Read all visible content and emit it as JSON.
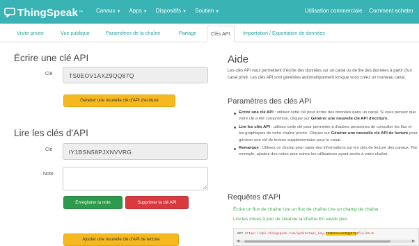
{
  "topnav": {
    "brand": "ThingSpeak",
    "brand_tm": "™",
    "menu": [
      "Canaux",
      "Apps",
      "Dispositifs",
      "Soutien"
    ],
    "right": [
      "Utilisation commerciale",
      "Comment acheter"
    ]
  },
  "tabs": [
    "Visite privée",
    "Vue publique",
    "Paramètres de la chaîne",
    "Partage",
    "Clés API",
    "Importation / Exportation de données"
  ],
  "write_section": {
    "title": "Écrire une clé API",
    "key_label": "Clé",
    "key_value": "TS0EOV1AXZ9QQ87Q",
    "generate_button": "Générer une nouvelle clé d'API d'écriture"
  },
  "read_section": {
    "title": "Lire les clés d'API",
    "key_label": "Clé",
    "key_value": "IY1BSN58PJXNVVRG",
    "note_label": "Note",
    "save_button": "Enregistrer la note",
    "delete_button": "Supprimer la clé API",
    "add_button": "Ajouter une nouvelle clé d'API de lecture"
  },
  "help": {
    "title": "Aide",
    "intro": "Les clés API vous permettent d'écrire des données sur un canal ou de lire des données à partir d'un canal privé. Les clés API sont générées automatiquement lorsque vous créez un nouveau canal.",
    "settings_title": "Paramètres des clés API",
    "bullets": [
      {
        "term": "Écrire une clé API",
        "text": " : utilisez cette clé pour écrire des données dans un canal. Si vous pensez que votre clé a été compromise, cliquez sur ",
        "bold2": "Générer une nouvelle clé API d'écriture."
      },
      {
        "term": "Lire les clés API",
        "text": " : utilisez cette clé pour permettre à d'autres personnes de consulter les flux et les graphiques de votre chaîne privée. Cliquez sur ",
        "bold2": "Générer une nouvelle clé API de lecture",
        "text2": " pour générer une clé de lecture supplémentaire pour le canal."
      },
      {
        "term": "Remarque",
        "text": " : Utilisez ce champ pour saisir des informations sur les clés de lecture des canaux. Par exemple, ajoutez des notes pour suivre les utilisateurs ayant accès à votre chaîne."
      }
    ],
    "requests_title": "Requêtes d'API",
    "links_line1": "Écrire un flux de chaîne Lire un flux de chaîne Lire un champ de chaîne",
    "links_line2": "Lire les mises à jour de l'état de la chaîne En savoir plus",
    "code_method": "GET",
    "code_url": "https://api.thingspeak.com/update?api_key=",
    "code_key": "TS0EOV1AXZ9QQ87Q",
    "code_rest": "&field1=0"
  },
  "colors": {
    "topbar": "#39b3b3",
    "link_green": "#3ea84f",
    "button_yellow": "#f6b81f",
    "button_green": "#2e9a4b",
    "button_red": "#d83a3f"
  }
}
